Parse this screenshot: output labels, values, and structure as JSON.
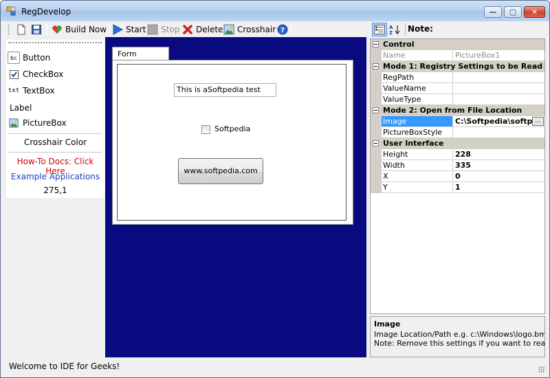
{
  "window": {
    "title": "RegDevelop",
    "min_glyph": "—",
    "max_glyph": "▢",
    "close_glyph": "✕"
  },
  "toolbar": {
    "build_label": "Build Now",
    "start_label": "Start",
    "stop_label": "Stop",
    "delete_label": "Delete",
    "crosshair_label": "Crosshair"
  },
  "toolbox": {
    "button_label": "Button",
    "checkbox_label": "CheckBox",
    "textbox_label": "TextBox",
    "label_label": "Label",
    "picturebox_label": "PictureBox",
    "crosshair_color_label": "Crosshair Color",
    "howto_link": "How-To Docs: Click Here",
    "examples_link": "Example Applications",
    "coords": "275,1",
    "icon_bc": "bc",
    "icon_txt": "txt"
  },
  "designer": {
    "tab_label": "Form Designer",
    "textbox_value": "This is aSoftpedia test",
    "checkbox_label": "Softpedia",
    "button_label": "www.softpedia.com"
  },
  "property_toolbar": {
    "note_label": "Note:"
  },
  "properties": {
    "cat_control": "Control",
    "name_label": "Name",
    "name_value": "PictureBox1",
    "cat_mode1": "Mode 1: Registry Settings to be Read",
    "regpath_label": "RegPath",
    "valuename_label": "ValueName",
    "valuetype_label": "ValueType",
    "cat_mode2": "Mode 2: Open from File Location",
    "image_label": "Image",
    "image_value": "C:\\Softpedia\\softpe",
    "ellipsis": "...",
    "pictureboxstyle_label": "PictureBoxStyle",
    "cat_ui": "User Interface",
    "height_label": "Height",
    "height_value": "228",
    "width_label": "Width",
    "width_value": "335",
    "x_label": "X",
    "x_value": "0",
    "y_label": "Y",
    "y_value": "1"
  },
  "help": {
    "title": "Image",
    "line1": "Image Location/Path e.g. c:\\Windows\\logo.bmp",
    "line2": "Note: Remove this settings if you want to read in ..."
  },
  "status": {
    "text": "Welcome to IDE for Geeks!"
  },
  "colors": {
    "designer_bg": "#0a0a80",
    "link_red": "#d40000",
    "link_blue": "#1a3fbf",
    "selection": "#3399ff"
  }
}
